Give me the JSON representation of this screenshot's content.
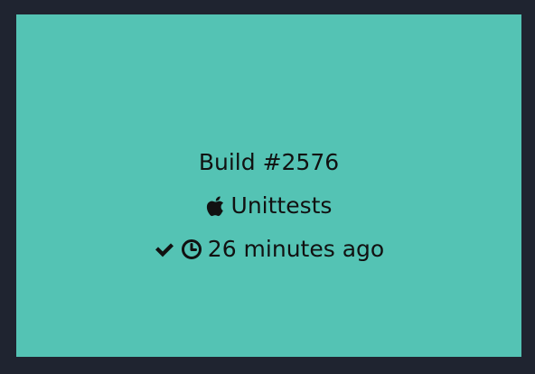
{
  "build": {
    "title": "Build #2576",
    "job_name": "Unittests",
    "time_ago": "26 minutes ago",
    "platform_icon": "apple-icon",
    "status_icon": "check-icon",
    "time_icon": "clock-icon"
  },
  "colors": {
    "page_background": "#1f2430",
    "tile_background": "#54c3b4",
    "text": "#111111"
  }
}
